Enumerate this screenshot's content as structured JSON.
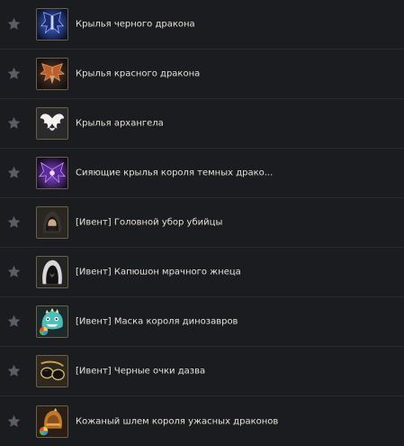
{
  "items": [
    {
      "name": "Крылья черного дракона",
      "icon": "black-dragon-wings-icon"
    },
    {
      "name": "Крылья красного дракона",
      "icon": "red-dragon-wings-icon"
    },
    {
      "name": "Крылья архангела",
      "icon": "archangel-wings-icon"
    },
    {
      "name": "Сияющие крылья короля темных драко...",
      "icon": "radiant-dark-king-wings-icon"
    },
    {
      "name": "[Ивент] Головной убор убийцы",
      "icon": "assassin-headgear-icon"
    },
    {
      "name": "[Ивент] Капюшон мрачного жнеца",
      "icon": "grim-reaper-hood-icon"
    },
    {
      "name": "[Ивент] Маска короля динозавров",
      "icon": "dinosaur-king-mask-icon"
    },
    {
      "name": "[Ивент] Черные очки дазва",
      "icon": "black-glasses-icon"
    },
    {
      "name": "Кожаный шлем короля ужасных драконов",
      "icon": "leather-dragon-king-helmet-icon"
    }
  ],
  "colors": {
    "background": "#1b1c20",
    "divider": "#2a2b30",
    "text": "#e6e2d6",
    "star": "#5a5c66",
    "icon_border": "#6a6046"
  }
}
